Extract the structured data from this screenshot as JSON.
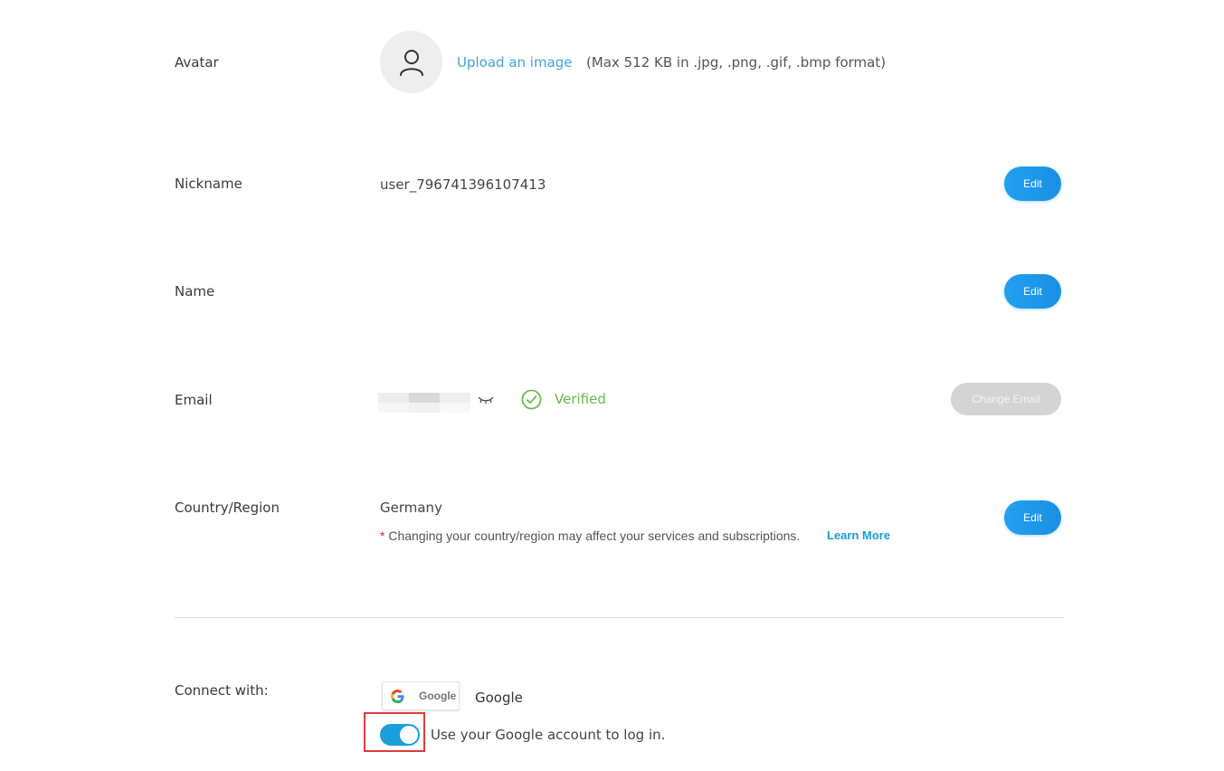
{
  "avatar": {
    "label": "Avatar",
    "upload_link": "Upload an image",
    "hint": "(Max 512 KB in .jpg, .png, .gif, .bmp format)",
    "icon": "user-icon"
  },
  "nickname": {
    "label": "Nickname",
    "value": "user_796741396107413",
    "edit_label": "Edit"
  },
  "name": {
    "label": "Name",
    "value": "",
    "edit_label": "Edit"
  },
  "email": {
    "label": "Email",
    "status": "Verified",
    "status_color": "#66b84a",
    "change_label": "Change Email",
    "toggle_icon": "eye-closed-icon"
  },
  "country": {
    "label": "Country/Region",
    "value": "Germany",
    "note_marker": "*",
    "note": "Changing your country/region may affect your services and subscriptions.",
    "learn_more": "Learn More",
    "edit_label": "Edit"
  },
  "connect": {
    "label": "Connect with:",
    "provider_button": "Google",
    "provider_name": "Google",
    "toggle_on": true,
    "toggle_text": "Use your Google account to log in."
  },
  "colors": {
    "accent": "#1b9fdc",
    "link": "#3fa5d8",
    "highlight": "#e23b3b"
  }
}
